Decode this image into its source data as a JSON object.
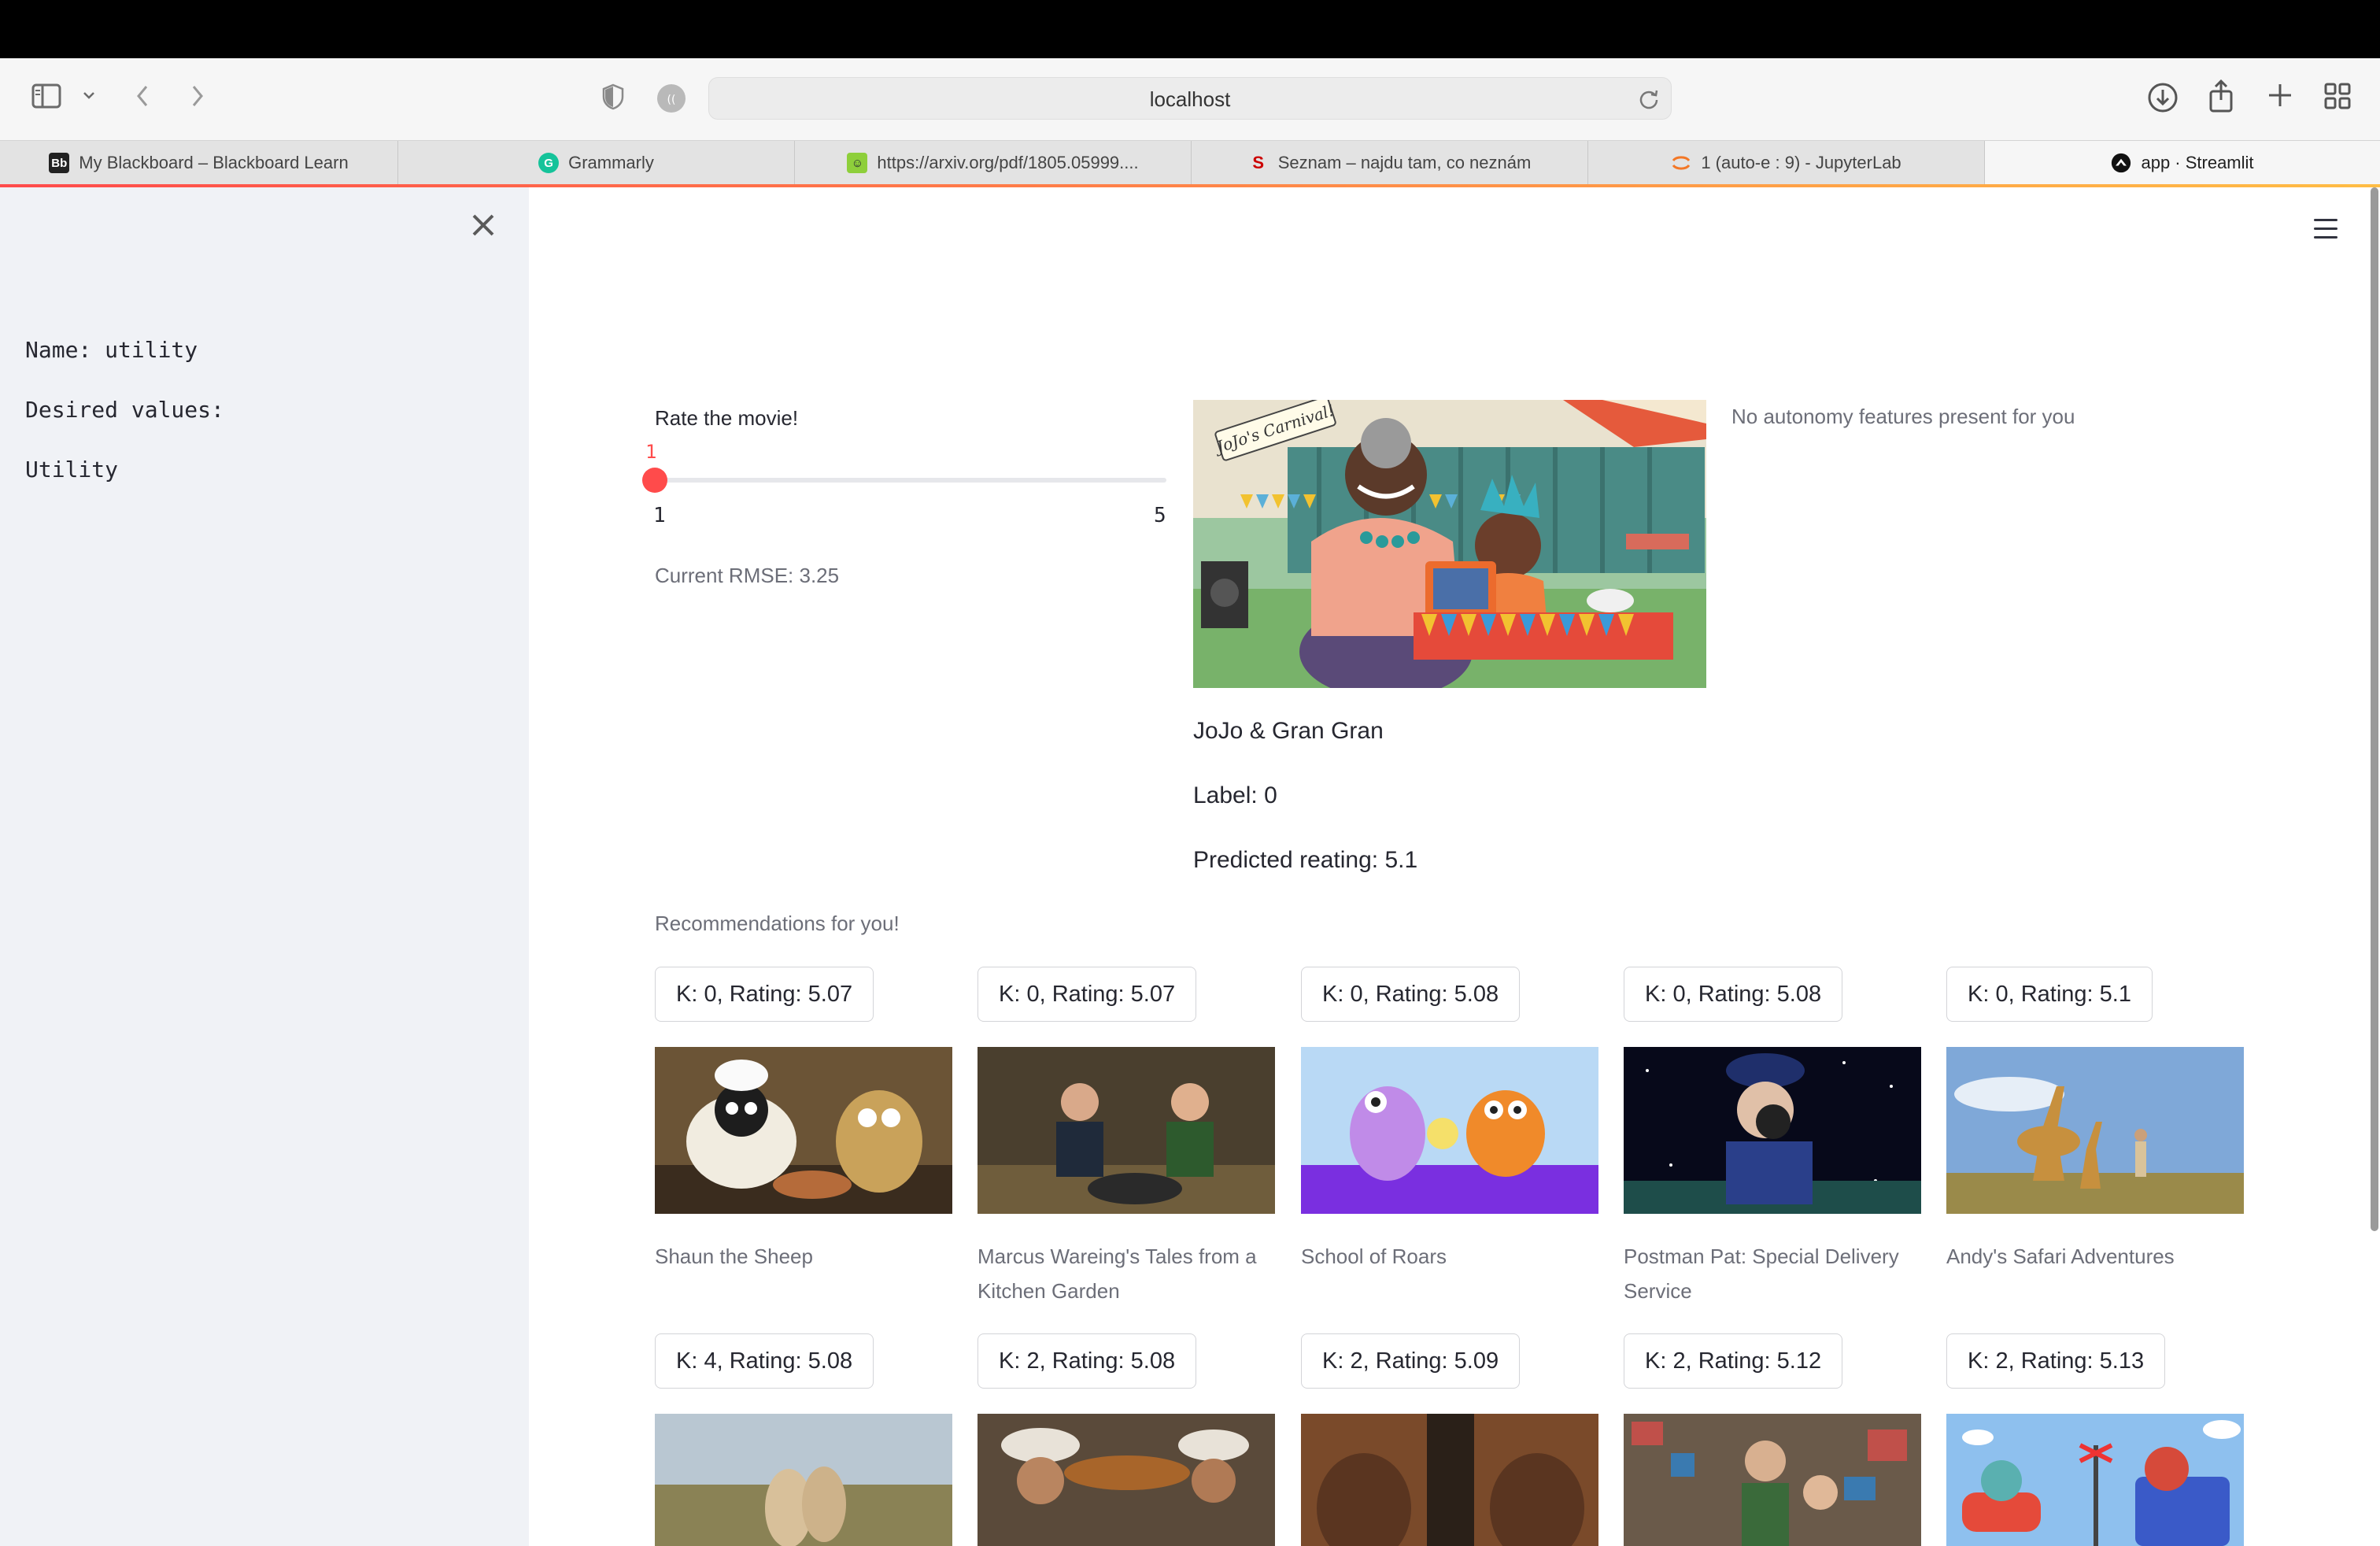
{
  "browser": {
    "url": "localhost",
    "tabs": [
      {
        "label": "My Blackboard – Blackboard Learn",
        "favicon": "Bb"
      },
      {
        "label": "Grammarly",
        "favicon": "G"
      },
      {
        "label": "https://arxiv.org/pdf/1805.05999....",
        "favicon": "smiley"
      },
      {
        "label": "Seznam – najdu tam, co neznám",
        "favicon": "S"
      },
      {
        "label": "1 (auto-e : 9) - JupyterLab",
        "favicon": "jupyter"
      },
      {
        "label": "app · Streamlit",
        "favicon": "streamlit"
      }
    ]
  },
  "sidebar": {
    "name_line": "Name: utility",
    "desired_line": "Desired values:",
    "value_line": "Utility"
  },
  "rating": {
    "label": "Rate the movie!",
    "current": "1",
    "min": "1",
    "max": "5",
    "value_fraction": 0,
    "rmse": "Current RMSE: 3.25"
  },
  "movie": {
    "title": "JoJo & Gran Gran",
    "label_text": "Label: 0",
    "predicted": "Predicted reating: 5.1",
    "banner_text": "JoJo's Carnival!"
  },
  "autonomy_note": "No autonomy features present for you",
  "recommendations": {
    "heading": "Recommendations for you!",
    "rows": [
      [
        {
          "button": "K: 0, Rating: 5.07",
          "title": "Shaun the Sheep"
        },
        {
          "button": "K: 0, Rating: 5.07",
          "title": "Marcus Wareing's Tales from a Kitchen Garden"
        },
        {
          "button": "K: 0, Rating: 5.08",
          "title": "School of Roars"
        },
        {
          "button": "K: 0, Rating: 5.08",
          "title": "Postman Pat: Special Delivery Service"
        },
        {
          "button": "K: 0, Rating: 5.1",
          "title": "Andy's Safari Adventures"
        }
      ],
      [
        {
          "button": "K: 4, Rating: 5.08"
        },
        {
          "button": "K: 2, Rating: 5.08"
        },
        {
          "button": "K: 2, Rating: 5.09"
        },
        {
          "button": "K: 2, Rating: 5.12"
        },
        {
          "button": "K: 2, Rating: 5.13"
        }
      ]
    ]
  },
  "colors": {
    "accent": "#ff4b4b",
    "sidebar_bg": "#f0f2f6",
    "text": "#262730",
    "muted": "#6c6e78"
  }
}
